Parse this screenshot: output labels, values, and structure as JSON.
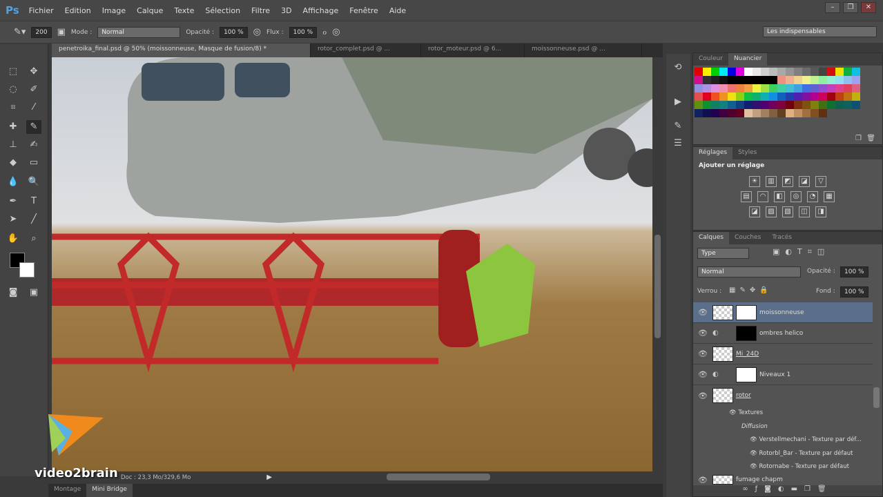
{
  "app": {
    "logo": "Ps"
  },
  "menu": [
    "Fichier",
    "Edition",
    "Image",
    "Calque",
    "Texte",
    "Sélection",
    "Filtre",
    "3D",
    "Affichage",
    "Fenêtre",
    "Aide"
  ],
  "window_buttons": [
    "–",
    "❐",
    "✕"
  ],
  "options": {
    "brush_size": "200",
    "mode_label": "Mode :",
    "mode_value": "Normal",
    "opacity_label": "Opacité :",
    "opacity_value": "100 %",
    "flow_label": "Flux :",
    "flow_value": "100 %",
    "workspace": "Les indispensables"
  },
  "doc_tabs": [
    {
      "label": "penetroika_final.psd @ 50% (moissonneuse, Masque de fusion/8) *",
      "active": true
    },
    {
      "label": "rotor_complet.psd @ ...",
      "active": false
    },
    {
      "label": "rotor_moteur.psd @ 6...",
      "active": false
    },
    {
      "label": "moissonneuse.psd @ ...",
      "active": false
    }
  ],
  "status": {
    "doc": "Doc : 23,3 Mo/329,6 Mo"
  },
  "bottom_tabs": [
    {
      "label": "Montage",
      "active": false
    },
    {
      "label": "Mini Bridge",
      "active": true
    }
  ],
  "watermark": "video2brain",
  "swatch_panel": {
    "tabs": [
      "Couleur",
      "Nuancier"
    ],
    "active": 1
  },
  "swatch_colors": [
    "#e00000",
    "#ffee00",
    "#00d000",
    "#00e8f0",
    "#0000e0",
    "#e000e0",
    "#ffffff",
    "#e8e8e8",
    "#d0d0d0",
    "#bcbcbc",
    "#a8a8a8",
    "#949494",
    "#808080",
    "#6c6c6c",
    "#585858",
    "#444444",
    "#d01010",
    "#f0e000",
    "#10b040",
    "#10c0e0",
    "#d0108a",
    "#303030",
    "#202020",
    "#101010",
    "#000000",
    "#000000",
    "#000000",
    "#000000",
    "#000000",
    "#000000",
    "#f09080",
    "#f0b090",
    "#f0d090",
    "#f0f090",
    "#c0f090",
    "#90f0a0",
    "#90f0d0",
    "#90e0f0",
    "#90c0f0",
    "#a0a0f0",
    "#9090e0",
    "#b090e0",
    "#e090e0",
    "#f090b0",
    "#f07070",
    "#f08040",
    "#f0a040",
    "#f0f040",
    "#a0e040",
    "#40d060",
    "#40d0a0",
    "#40c0d0",
    "#40a0e0",
    "#4070e0",
    "#6060d0",
    "#9050d0",
    "#c040c0",
    "#e04090",
    "#e04060",
    "#e06080",
    "#e05050",
    "#e00020",
    "#f05020",
    "#f09020",
    "#f0e010",
    "#90d010",
    "#10c040",
    "#10b070",
    "#10b0b0",
    "#1090e0",
    "#1060c0",
    "#2040b0",
    "#5020b0",
    "#8010a0",
    "#b00090",
    "#d00060",
    "#a00010",
    "#c04010",
    "#c07010",
    "#c0b010",
    "#609010",
    "#109030",
    "#108060",
    "#108080",
    "#106090",
    "#104080",
    "#102070",
    "#301070",
    "#500070",
    "#700060",
    "#800040",
    "#700010",
    "#803010",
    "#805010",
    "#808010",
    "#407010",
    "#107030",
    "#106050",
    "#106060",
    "#105070",
    "#102060",
    "#101050",
    "#200050",
    "#400040",
    "#500030",
    "#600020",
    "#e0c0a0",
    "#c0a080",
    "#a08060",
    "#806040",
    "#604020",
    "#e0b080",
    "#c09060",
    "#a07040",
    "#805020",
    "#603010",
    "",
    "",
    "",
    ""
  ],
  "adjust_panel": {
    "tabs": [
      "Réglages",
      "Styles"
    ],
    "title": "Ajouter un réglage",
    "icons": [
      [
        "☀",
        "▥",
        "◩",
        "◪",
        "▽"
      ],
      [
        "▤",
        "◠",
        "◧",
        "◎",
        "◔",
        "▦"
      ],
      [
        "◪",
        "▨",
        "▧",
        "◫",
        "◨"
      ]
    ]
  },
  "layers_panel": {
    "tabs": [
      "Calques",
      "Couches",
      "Tracés"
    ],
    "filter": "Type",
    "blend": "Normal",
    "opacity_label": "Opacité :",
    "opacity": "100 %",
    "lock_label": "Verrou :",
    "fill_label": "Fond :",
    "fill": "100 %",
    "layers": [
      {
        "name": "moissonneuse",
        "selected": true
      },
      {
        "name": "ombres helico",
        "selected": false
      },
      {
        "name": "Mi_24D",
        "selected": false
      },
      {
        "name": "Niveaux 1",
        "selected": false
      },
      {
        "name": "rotor",
        "selected": false
      }
    ],
    "sub_items": [
      "Textures",
      "Diffusion",
      "Verstellmechani - Texture par déf...",
      "Rotorbl_Bar - Texture par défaut",
      "Rotornabe - Texture par défaut"
    ],
    "last_layer": "fumage chapm"
  }
}
